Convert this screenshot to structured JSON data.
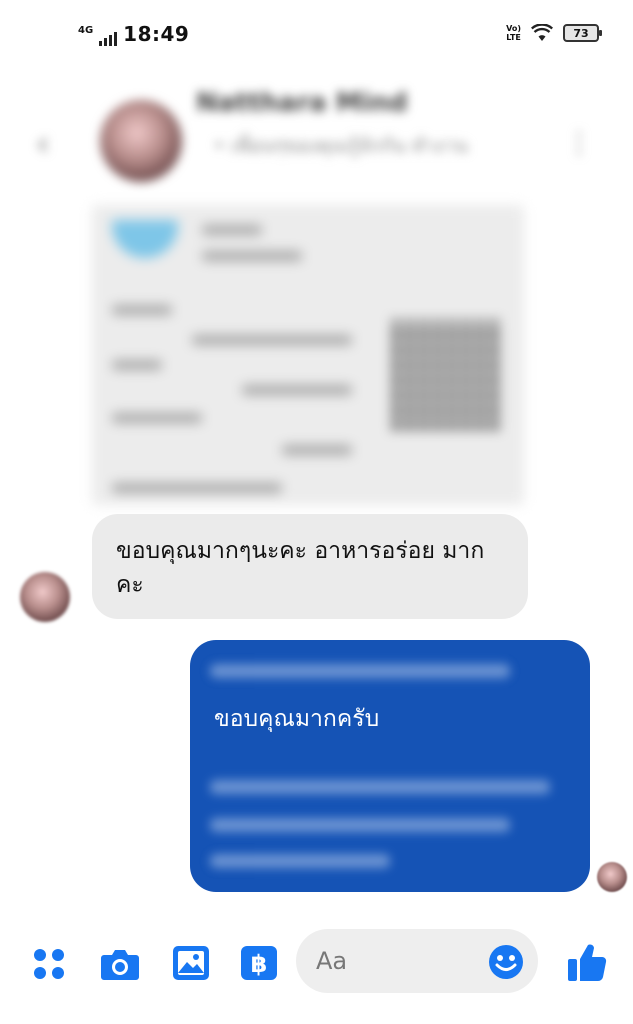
{
  "status_bar": {
    "network_type": "4G",
    "time": "18:49",
    "volte": [
      "Vo)",
      "LTE"
    ],
    "battery": "73"
  },
  "header": {
    "contact_name": "Natthara Mind",
    "contact_subtitle": "ㅤ• เพื่อนๆของคุณรู้จักกัน ทำงาน"
  },
  "messages": {
    "incoming_text": "ขอบคุณมากๆนะคะ อาหารอร่อย มากคะ",
    "outgoing_text": "ขอบคุณมากครับ"
  },
  "composer": {
    "placeholder": "Aa"
  },
  "colors": {
    "accent": "#1877f2",
    "outgoing_bubble": "#1553b5",
    "incoming_bubble": "#ebebeb"
  },
  "icons": [
    "menu-icon",
    "camera-icon",
    "gallery-icon",
    "pay-icon",
    "emoji-icon",
    "like-icon"
  ]
}
